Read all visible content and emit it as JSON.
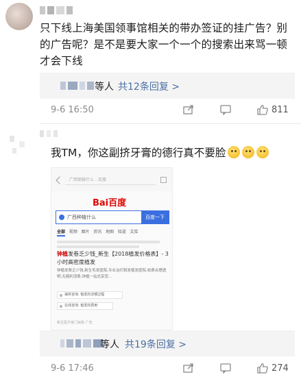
{
  "comment1": {
    "text": "只下线上海美国领事馆相关的带办签证的挂广告？别的广告呢？是不是要大家一个一个的搜索出来骂一顿才会下线",
    "reply_suffix": "等人",
    "reply_link": "共12条回复 >",
    "time": "9-6 16:50",
    "like_count": "811"
  },
  "comment2": {
    "text": "我TM，你这副挤牙膏的德行真不要脸",
    "emoji_icon": "smiling-face-icon",
    "reply_suffix": "等人",
    "reply_link": "共19条回复 >",
    "time": "9-6 17:46",
    "like_count": "274"
  },
  "screenshot": {
    "url_text": "广西钢铸什么 - 百度",
    "logo": "Bai百度",
    "query": "广西种植什么",
    "search_button": "百度一下",
    "tabs": [
      "全部",
      "视频",
      "图片",
      "资讯",
      "地图",
      "知道",
      "文库"
    ],
    "result_title_red": "钟植",
    "result_title": "发卷乏少钱_新生【2018植发价格表】- 3小时高密度植发",
    "desc": "钟植发费乏少钱,新生毛发医院,专业治疗脱发植发医院,收费合理透明,无痛利消费,钟植一站式享受...",
    "chip1": "抽奖咨询: 植发的详细过程",
    "chip2": "在线咨询: 植发的费用",
    "footer": "新生医疗官门目院   广告"
  },
  "colors": {
    "link": "#4a6ea4",
    "meta": "#8a8a8a",
    "reply_bg": "#f4f4f4",
    "baidu_red": "#e10602",
    "baidu_blue": "#3b6fe0"
  }
}
